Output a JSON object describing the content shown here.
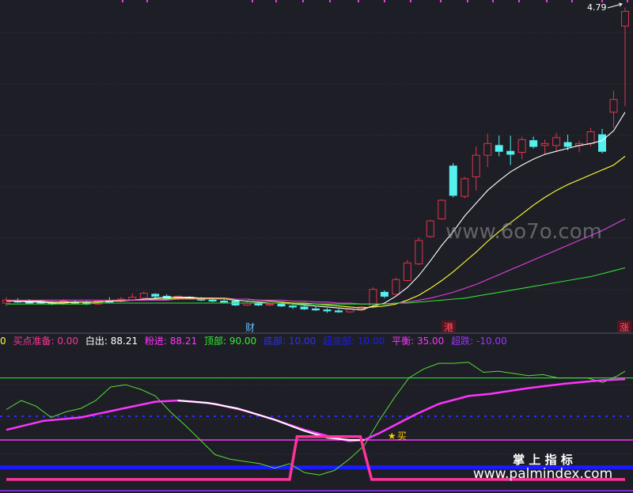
{
  "colors": {
    "background": "#1e1f26",
    "up": "#e0334a",
    "down": "#55f0f0",
    "ma_short": "#ffffff",
    "ma_mid": "#ffff33",
    "ma_long": "#e040e0",
    "ma_longest": "#33dd33",
    "white_line": "#ffffff",
    "pink_line": "#ff33ff",
    "top_line": "#33ee33",
    "buy_step": "#ff3399",
    "blue_band": "#1a1aff",
    "dashed_blue": "#2e2eff",
    "purple_line": "#9933ff",
    "star": "#ffcc00",
    "price_tag": "#ffffff"
  },
  "price_label": "4.79",
  "markers": [
    {
      "label": "财",
      "style": "blue"
    },
    {
      "label": "港",
      "style": "red"
    },
    {
      "label": "涨",
      "style": "red"
    }
  ],
  "buy_marker": {
    "star": "★",
    "label": "买"
  },
  "watermarks": {
    "site1": "www.6o7o.com",
    "cn_title": "掌 上 指 标",
    "site2": "www.palmindex.com"
  },
  "indicator_row": [
    {
      "text": "0",
      "color": "#ffff33"
    },
    {
      "text": "买点准备: 0.00",
      "color": "#ff3399"
    },
    {
      "text": "白出: 88.21",
      "color": "#ffffff"
    },
    {
      "text": "粉进: 88.21",
      "color": "#ff33ff"
    },
    {
      "text": "顶部: 90.00",
      "color": "#33ee33"
    },
    {
      "text": "底部: 10.00",
      "color": "#2e2eff"
    },
    {
      "text": "超底部: 10.00",
      "color": "#1a1aff"
    },
    {
      "text": "平衡: 35.00",
      "color": "#ff33ff"
    },
    {
      "text": "超跌: -10.00",
      "color": "#9933ff"
    }
  ],
  "chart_data": [
    {
      "type": "candlestick",
      "title": "",
      "series_colors": "up=red, down=cyan",
      "ylim": [
        1.6,
        4.85
      ],
      "max_label": 4.79,
      "candles": [
        {
          "o": 1.77,
          "h": 1.83,
          "l": 1.74,
          "c": 1.8
        },
        {
          "o": 1.79,
          "h": 1.82,
          "l": 1.77,
          "c": 1.78
        },
        {
          "o": 1.79,
          "h": 1.81,
          "l": 1.76,
          "c": 1.77
        },
        {
          "o": 1.78,
          "h": 1.8,
          "l": 1.76,
          "c": 1.77
        },
        {
          "o": 1.77,
          "h": 1.79,
          "l": 1.75,
          "c": 1.76
        },
        {
          "o": 1.76,
          "h": 1.81,
          "l": 1.75,
          "c": 1.79
        },
        {
          "o": 1.78,
          "h": 1.8,
          "l": 1.76,
          "c": 1.77
        },
        {
          "o": 1.77,
          "h": 1.79,
          "l": 1.75,
          "c": 1.76
        },
        {
          "o": 1.76,
          "h": 1.8,
          "l": 1.75,
          "c": 1.79
        },
        {
          "o": 1.79,
          "h": 1.83,
          "l": 1.77,
          "c": 1.78
        },
        {
          "o": 1.79,
          "h": 1.83,
          "l": 1.78,
          "c": 1.81
        },
        {
          "o": 1.8,
          "h": 1.87,
          "l": 1.79,
          "c": 1.83
        },
        {
          "o": 1.82,
          "h": 1.89,
          "l": 1.81,
          "c": 1.87
        },
        {
          "o": 1.86,
          "h": 1.87,
          "l": 1.82,
          "c": 1.84
        },
        {
          "o": 1.84,
          "h": 1.86,
          "l": 1.81,
          "c": 1.82
        },
        {
          "o": 1.82,
          "h": 1.85,
          "l": 1.8,
          "c": 1.84
        },
        {
          "o": 1.83,
          "h": 1.84,
          "l": 1.81,
          "c": 1.82
        },
        {
          "o": 1.82,
          "h": 1.83,
          "l": 1.79,
          "c": 1.8
        },
        {
          "o": 1.8,
          "h": 1.82,
          "l": 1.78,
          "c": 1.79
        },
        {
          "o": 1.79,
          "h": 1.81,
          "l": 1.77,
          "c": 1.78
        },
        {
          "o": 1.79,
          "h": 1.8,
          "l": 1.74,
          "c": 1.75
        },
        {
          "o": 1.75,
          "h": 1.79,
          "l": 1.74,
          "c": 1.77
        },
        {
          "o": 1.77,
          "h": 1.78,
          "l": 1.74,
          "c": 1.75
        },
        {
          "o": 1.75,
          "h": 1.77,
          "l": 1.74,
          "c": 1.76
        },
        {
          "o": 1.76,
          "h": 1.77,
          "l": 1.73,
          "c": 1.74
        },
        {
          "o": 1.74,
          "h": 1.75,
          "l": 1.71,
          "c": 1.73
        },
        {
          "o": 1.73,
          "h": 1.74,
          "l": 1.7,
          "c": 1.71
        },
        {
          "o": 1.71,
          "h": 1.73,
          "l": 1.69,
          "c": 1.7
        },
        {
          "o": 1.7,
          "h": 1.72,
          "l": 1.67,
          "c": 1.69
        },
        {
          "o": 1.69,
          "h": 1.71,
          "l": 1.67,
          "c": 1.68
        },
        {
          "o": 1.68,
          "h": 1.72,
          "l": 1.67,
          "c": 1.71
        },
        {
          "o": 1.7,
          "h": 1.74,
          "l": 1.69,
          "c": 1.73
        },
        {
          "o": 1.73,
          "h": 1.93,
          "l": 1.72,
          "c": 1.91
        },
        {
          "o": 1.88,
          "h": 1.9,
          "l": 1.82,
          "c": 1.84
        },
        {
          "o": 1.86,
          "h": 2.03,
          "l": 1.85,
          "c": 2.01
        },
        {
          "o": 2.0,
          "h": 2.21,
          "l": 1.99,
          "c": 2.18
        },
        {
          "o": 2.17,
          "h": 2.44,
          "l": 2.16,
          "c": 2.41
        },
        {
          "o": 2.45,
          "h": 2.62,
          "l": 2.44,
          "c": 2.61
        },
        {
          "o": 2.63,
          "h": 2.83,
          "l": 2.62,
          "c": 2.82
        },
        {
          "o": 3.17,
          "h": 3.2,
          "l": 2.85,
          "c": 2.87
        },
        {
          "o": 2.86,
          "h": 3.06,
          "l": 2.84,
          "c": 3.04
        },
        {
          "o": 3.06,
          "h": 3.37,
          "l": 2.92,
          "c": 3.28
        },
        {
          "o": 3.28,
          "h": 3.5,
          "l": 3.16,
          "c": 3.4
        },
        {
          "o": 3.38,
          "h": 3.48,
          "l": 3.27,
          "c": 3.32
        },
        {
          "o": 3.32,
          "h": 3.48,
          "l": 3.18,
          "c": 3.29
        },
        {
          "o": 3.31,
          "h": 3.47,
          "l": 3.24,
          "c": 3.44
        },
        {
          "o": 3.43,
          "h": 3.47,
          "l": 3.35,
          "c": 3.37
        },
        {
          "o": 3.38,
          "h": 3.44,
          "l": 3.29,
          "c": 3.4
        },
        {
          "o": 3.38,
          "h": 3.51,
          "l": 3.32,
          "c": 3.46
        },
        {
          "o": 3.41,
          "h": 3.49,
          "l": 3.33,
          "c": 3.37
        },
        {
          "o": 3.38,
          "h": 3.43,
          "l": 3.31,
          "c": 3.4
        },
        {
          "o": 3.4,
          "h": 3.56,
          "l": 3.37,
          "c": 3.52
        },
        {
          "o": 3.49,
          "h": 3.55,
          "l": 3.3,
          "c": 3.32
        },
        {
          "o": 3.72,
          "h": 3.94,
          "l": 3.56,
          "c": 3.85
        },
        {
          "o": 4.6,
          "h": 4.79,
          "l": 3.78,
          "c": 4.75
        }
      ],
      "moving_averages": [
        {
          "color": "white",
          "values": [
            1.79,
            1.79,
            1.78,
            1.78,
            1.77,
            1.77,
            1.78,
            1.78,
            1.78,
            1.79,
            1.8,
            1.8,
            1.81,
            1.82,
            1.83,
            1.83,
            1.83,
            1.82,
            1.82,
            1.81,
            1.8,
            1.79,
            1.78,
            1.77,
            1.77,
            1.76,
            1.75,
            1.74,
            1.73,
            1.72,
            1.71,
            1.7,
            1.74,
            1.77,
            1.84,
            1.93,
            2.05,
            2.2,
            2.36,
            2.5,
            2.66,
            2.79,
            2.92,
            3.02,
            3.11,
            3.18,
            3.24,
            3.29,
            3.32,
            3.35,
            3.38,
            3.4,
            3.43,
            3.53,
            3.72
          ]
        },
        {
          "color": "yellow",
          "values": [
            1.79,
            1.79,
            1.79,
            1.79,
            1.78,
            1.78,
            1.78,
            1.78,
            1.78,
            1.79,
            1.79,
            1.8,
            1.8,
            1.81,
            1.81,
            1.82,
            1.82,
            1.82,
            1.82,
            1.82,
            1.81,
            1.81,
            1.8,
            1.79,
            1.78,
            1.77,
            1.77,
            1.76,
            1.75,
            1.74,
            1.73,
            1.72,
            1.73,
            1.74,
            1.76,
            1.8,
            1.85,
            1.92,
            2.0,
            2.09,
            2.19,
            2.29,
            2.4,
            2.5,
            2.59,
            2.68,
            2.77,
            2.85,
            2.92,
            2.98,
            3.03,
            3.08,
            3.13,
            3.18,
            3.27
          ]
        },
        {
          "color": "magenta",
          "values": [
            1.8,
            1.8,
            1.8,
            1.8,
            1.8,
            1.8,
            1.8,
            1.8,
            1.8,
            1.8,
            1.8,
            1.8,
            1.8,
            1.8,
            1.8,
            1.81,
            1.81,
            1.81,
            1.81,
            1.81,
            1.81,
            1.81,
            1.8,
            1.8,
            1.8,
            1.79,
            1.79,
            1.78,
            1.78,
            1.77,
            1.77,
            1.76,
            1.76,
            1.76,
            1.77,
            1.78,
            1.8,
            1.82,
            1.85,
            1.88,
            1.92,
            1.96,
            2.01,
            2.06,
            2.11,
            2.16,
            2.21,
            2.26,
            2.31,
            2.36,
            2.41,
            2.46,
            2.51,
            2.57,
            2.63
          ]
        },
        {
          "color": "green",
          "values": [
            1.76,
            1.76,
            1.76,
            1.76,
            1.76,
            1.76,
            1.76,
            1.76,
            1.77,
            1.77,
            1.77,
            1.77,
            1.77,
            1.77,
            1.77,
            1.77,
            1.77,
            1.77,
            1.77,
            1.77,
            1.77,
            1.77,
            1.77,
            1.77,
            1.77,
            1.76,
            1.76,
            1.76,
            1.76,
            1.76,
            1.76,
            1.76,
            1.76,
            1.76,
            1.77,
            1.77,
            1.78,
            1.79,
            1.8,
            1.81,
            1.82,
            1.84,
            1.86,
            1.88,
            1.9,
            1.92,
            1.94,
            1.96,
            1.98,
            2.0,
            2.02,
            2.04,
            2.07,
            2.1,
            2.13
          ]
        }
      ]
    },
    {
      "type": "line",
      "title": "",
      "ylim": [
        -12,
        115
      ],
      "reference_levels": [
        {
          "label": "顶部",
          "value": 90
        },
        {
          "label": "平衡",
          "value": 35
        },
        {
          "label": "底部",
          "value": 10
        },
        {
          "label": "超底部",
          "value": 10
        },
        {
          "label": "超跌",
          "value": -10
        }
      ],
      "series": [
        {
          "color": "green",
          "values": [
            [
              0,
              62
            ],
            [
              4,
              70
            ],
            [
              8,
              65
            ],
            [
              12,
              55
            ],
            [
              16,
              60
            ],
            [
              20,
              63
            ],
            [
              24,
              70
            ],
            [
              28,
              82
            ],
            [
              32,
              84
            ],
            [
              36,
              80
            ],
            [
              40,
              74
            ],
            [
              44,
              60
            ],
            [
              48,
              48
            ],
            [
              52,
              35
            ],
            [
              56,
              22
            ],
            [
              60,
              18
            ],
            [
              64,
              16
            ],
            [
              68,
              14
            ],
            [
              72,
              10
            ],
            [
              76,
              14
            ],
            [
              80,
              6
            ],
            [
              84,
              4
            ],
            [
              88,
              8
            ],
            [
              92,
              18
            ],
            [
              96,
              30
            ],
            [
              100,
              52
            ],
            [
              104,
              72
            ],
            [
              108,
              90
            ],
            [
              112,
              98
            ],
            [
              116,
              103
            ],
            [
              120,
              103
            ],
            [
              124,
              104
            ],
            [
              128,
              95
            ],
            [
              132,
              96
            ],
            [
              136,
              94
            ],
            [
              140,
              92
            ],
            [
              144,
              93
            ],
            [
              148,
              90
            ],
            [
              152,
              90
            ],
            [
              156,
              90
            ],
            [
              160,
              86
            ],
            [
              164,
              92
            ],
            [
              166,
              96
            ]
          ]
        },
        {
          "color": "magenta",
          "values": [
            [
              0,
              44
            ],
            [
              10,
              52
            ],
            [
              20,
              55
            ],
            [
              30,
              62
            ],
            [
              40,
              69
            ],
            [
              46,
              70
            ],
            [
              50,
              69
            ],
            [
              56,
              67
            ],
            [
              64,
              61
            ],
            [
              72,
              53
            ],
            [
              80,
              44
            ],
            [
              88,
              37
            ],
            [
              92,
              34
            ],
            [
              96,
              35
            ],
            [
              100,
              41
            ],
            [
              110,
              58
            ],
            [
              116,
              67
            ],
            [
              124,
              74
            ],
            [
              130,
              76
            ],
            [
              140,
              81
            ],
            [
              150,
              85
            ],
            [
              160,
              88
            ],
            [
              166,
              89
            ]
          ]
        },
        {
          "color": "white",
          "values": [
            [
              46,
              70
            ],
            [
              54,
              68
            ],
            [
              62,
              63
            ],
            [
              72,
              53
            ],
            [
              80,
              43
            ],
            [
              86,
              37
            ],
            [
              92,
              35
            ],
            [
              96,
              35
            ]
          ]
        },
        {
          "color": "deeppink",
          "values": [
            [
              0,
              0
            ],
            [
              76,
              0
            ],
            [
              78,
              38
            ],
            [
              95,
              38
            ],
            [
              98,
              0
            ],
            [
              166,
              0
            ]
          ]
        }
      ],
      "buy_signal_x": 104
    }
  ]
}
